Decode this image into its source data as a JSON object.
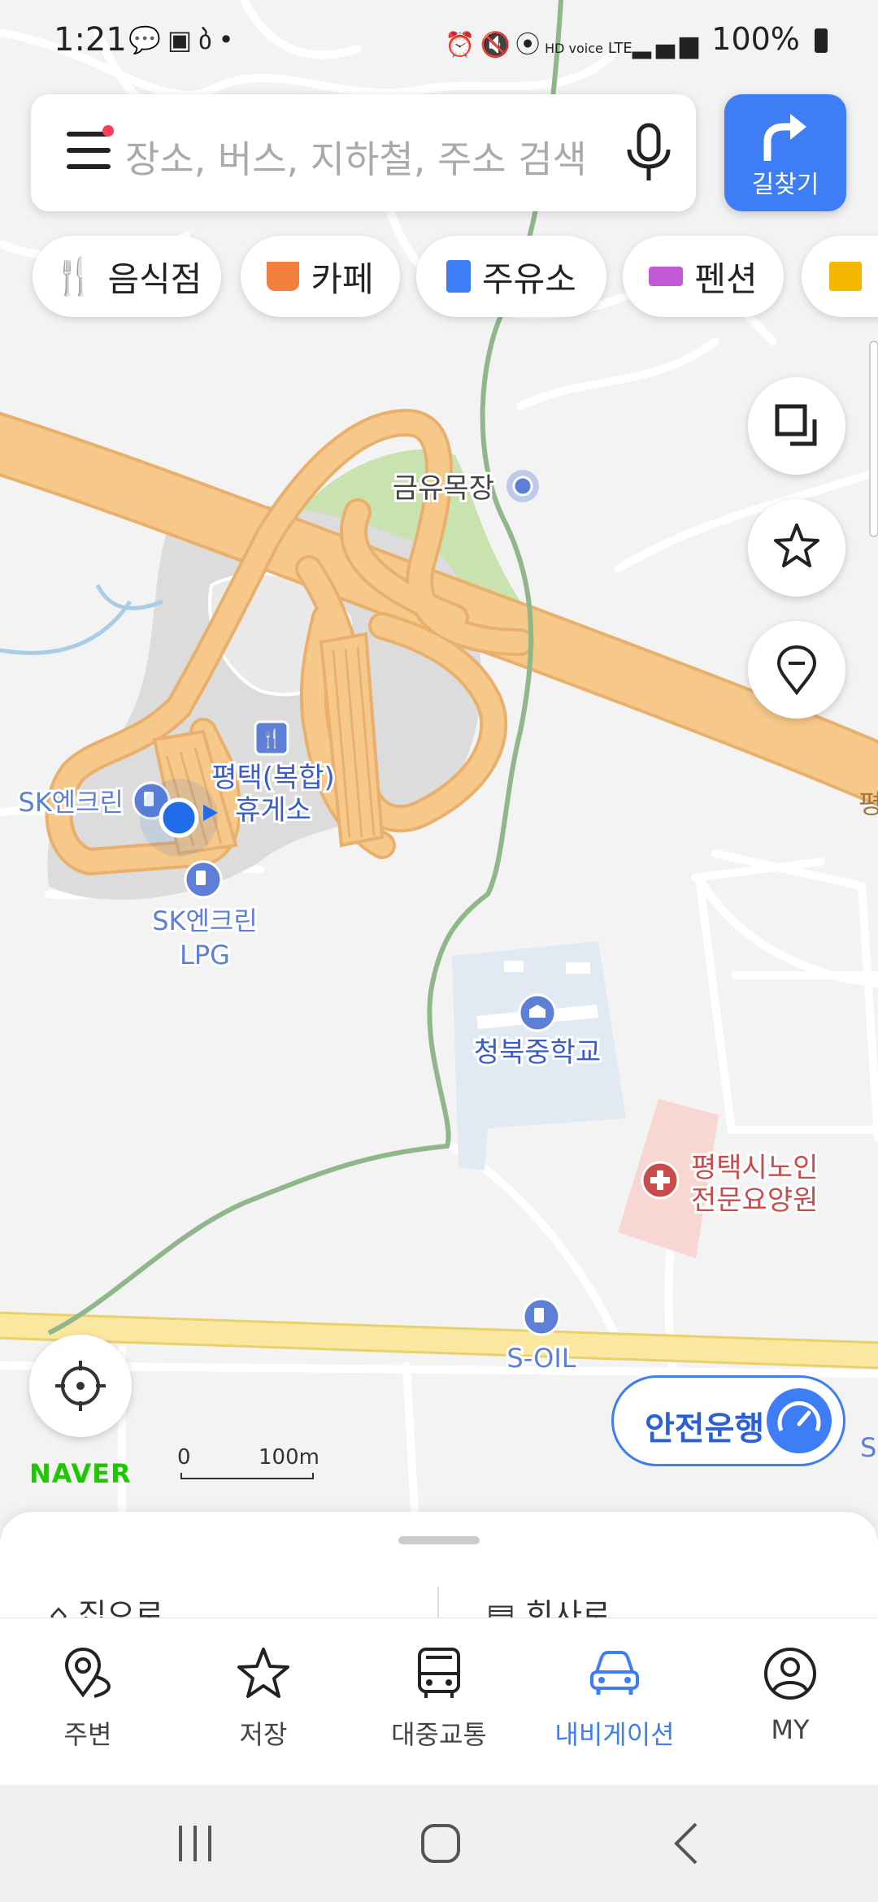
{
  "status_bar": {
    "time": "1:21",
    "battery": "100%",
    "left_icons": [
      "kakaotalk-icon",
      "gallery-icon",
      "app-icon",
      "dot-icon"
    ],
    "right_icons": [
      "alarm-icon",
      "mute-icon",
      "location-icon",
      "hd-voice-icon",
      "lte-icon",
      "signal-icon",
      "battery-icon"
    ],
    "hd_voice": "HD voice",
    "network": "LTE"
  },
  "search": {
    "placeholder": "장소, 버스, 지하철, 주소 검색"
  },
  "route_button": {
    "label": "길찾기"
  },
  "categories": [
    {
      "label": "음식점",
      "icon": "fork-knife-icon",
      "color": "#f0803c"
    },
    {
      "label": "카페",
      "icon": "cup-icon",
      "color": "#f0803c"
    },
    {
      "label": "주유소",
      "icon": "gas-pump-icon",
      "color": "#3d7ef6"
    },
    {
      "label": "펜션",
      "icon": "bed-icon",
      "color": "#c25ad8"
    },
    {
      "label": "",
      "icon": "store-icon",
      "color": "#f5b800"
    }
  ],
  "map": {
    "labels": {
      "ranch": "금유목장",
      "rest_area_line1": "평택(복합)",
      "rest_area_line2": "휴게소",
      "sk_station": "SK엔크린",
      "sk_lpg_line1": "SK엔크린",
      "sk_lpg_line2": "LPG",
      "school": "청북중학교",
      "hospital_line1": "평택시노인",
      "hospital_line2": "전문요양원",
      "soil": "S-OIL",
      "road_edge": "평",
      "edge_right": "S"
    },
    "brand": "NAVER",
    "scale": {
      "zero": "0",
      "max": "100m"
    },
    "colors": {
      "highway": "#f6c88a",
      "green_area": "#c8e2b0",
      "school_zone": "#e1eaf3",
      "hospital_zone": "#f8d7d2",
      "poi_blue": "#5d7fd6",
      "hospital_red": "#c84c4c",
      "location_dot": "#1f6be8"
    }
  },
  "safe_drive_button": {
    "label": "안전운행"
  },
  "bottom_sheet": {
    "home_label": "집으로",
    "work_label": "회사로"
  },
  "tabs": [
    {
      "label": "주변",
      "icon": "map-pin-icon",
      "active": false
    },
    {
      "label": "저장",
      "icon": "star-icon",
      "active": false
    },
    {
      "label": "대중교통",
      "icon": "bus-icon",
      "active": false
    },
    {
      "label": "내비게이션",
      "icon": "car-icon",
      "active": true
    },
    {
      "label": "MY",
      "icon": "profile-icon",
      "active": false
    }
  ],
  "accent_color": "#3d7ef6"
}
